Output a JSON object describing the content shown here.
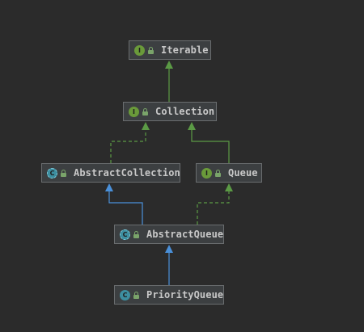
{
  "colors": {
    "background": "#2b2b2b",
    "node_background": "#3c3f41",
    "node_border": "#6a6d6f",
    "label": "#c8c8c8",
    "interface_badge": "#6a9a3a",
    "class_badge": "#3d8ea0",
    "extends_edge": "#4a90d9",
    "implements_edge": "#5b9a45",
    "lock": "#7aa46a"
  },
  "nodes": {
    "iterable": {
      "label": "Iterable",
      "badge": "I",
      "kind": "interface"
    },
    "collection": {
      "label": "Collection",
      "badge": "I",
      "kind": "interface"
    },
    "abstract_collection": {
      "label": "AbstractCollection",
      "badge": "C",
      "kind": "abstract-class"
    },
    "queue": {
      "label": "Queue",
      "badge": "I",
      "kind": "interface"
    },
    "abstract_queue": {
      "label": "AbstractQueue",
      "badge": "C",
      "kind": "abstract-class"
    },
    "priority_queue": {
      "label": "PriorityQueue",
      "badge": "C",
      "kind": "class"
    }
  },
  "edges": [
    {
      "from": "collection",
      "to": "iterable",
      "type": "extends-interface"
    },
    {
      "from": "abstract_collection",
      "to": "collection",
      "type": "implements"
    },
    {
      "from": "queue",
      "to": "collection",
      "type": "extends-interface"
    },
    {
      "from": "abstract_queue",
      "to": "abstract_collection",
      "type": "extends"
    },
    {
      "from": "abstract_queue",
      "to": "queue",
      "type": "implements"
    },
    {
      "from": "priority_queue",
      "to": "abstract_queue",
      "type": "extends"
    }
  ]
}
